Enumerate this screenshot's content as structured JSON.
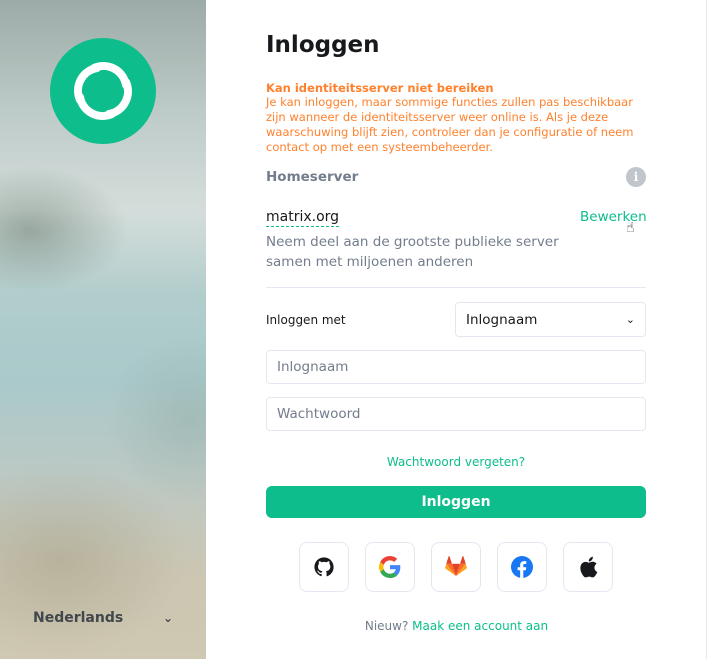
{
  "language": {
    "selected": "Nederlands"
  },
  "title": "Inloggen",
  "warning": {
    "title": "Kan identiteitsserver niet bereiken",
    "body": "Je kan inloggen, maar sommige functies zullen pas beschikbaar zijn wanneer de identiteitsserver weer online is. Als je deze waarschuwing blijft zien, controleer dan je configuratie of neem contact op met een systeembeheerder."
  },
  "homeserver": {
    "label": "Homeserver",
    "name": "matrix.org",
    "edit_label": "Bewerken",
    "description": "Neem deel aan de grootste publieke server samen met miljoenen anderen"
  },
  "login_with": {
    "label": "Inloggen met",
    "selected": "Inlognaam"
  },
  "fields": {
    "username_placeholder": "Inlognaam",
    "password_placeholder": "Wachtwoord"
  },
  "forgot_password": "Wachtwoord vergeten?",
  "login_button": "Inloggen",
  "sso_providers": [
    "github-icon",
    "google-icon",
    "gitlab-icon",
    "facebook-icon",
    "apple-icon"
  ],
  "signup": {
    "prompt": "Nieuw?",
    "link": "Maak een account aan"
  },
  "colors": {
    "accent": "#0dbd8b",
    "warning": "#ff812d",
    "muted": "#737d8c"
  }
}
